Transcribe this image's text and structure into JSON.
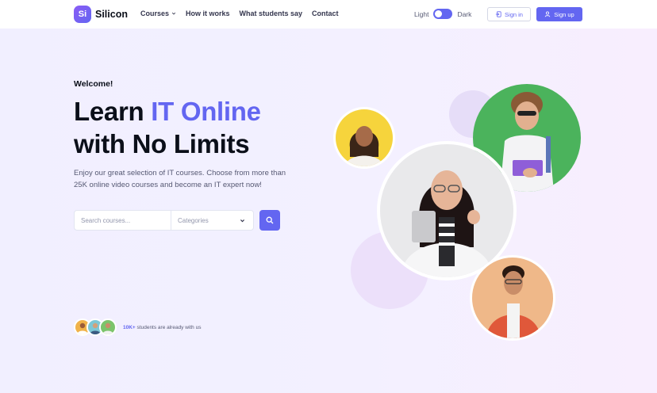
{
  "nav": {
    "brand_mark": "Si",
    "brand_name": "Silicon",
    "menu": [
      {
        "label": "Courses",
        "has_dropdown": true
      },
      {
        "label": "How it works"
      },
      {
        "label": "What students say"
      },
      {
        "label": "Contact"
      }
    ],
    "mode_light": "Light",
    "mode_dark": "Dark",
    "signin_label": "Sign in",
    "signup_label": "Sign up"
  },
  "hero": {
    "welcome": "Welcome!",
    "headline_part1": "Learn ",
    "headline_accent": "IT Online",
    "headline_part2": "with No Limits",
    "subtext": "Enjoy our great selection of IT courses. Choose from more than 25K online video courses and become an IT expert now!",
    "search_placeholder": "Search courses...",
    "categories_label": "Categories",
    "students_count": "10K+",
    "students_text": " students are already with us"
  },
  "colors": {
    "accent": "#6366f1",
    "text_dark": "#0b0f19",
    "text_muted": "#565973",
    "yellow": "#f6d43c",
    "green": "#4bb35c",
    "peach": "#efb889",
    "lavender": "#e8e2fb"
  }
}
